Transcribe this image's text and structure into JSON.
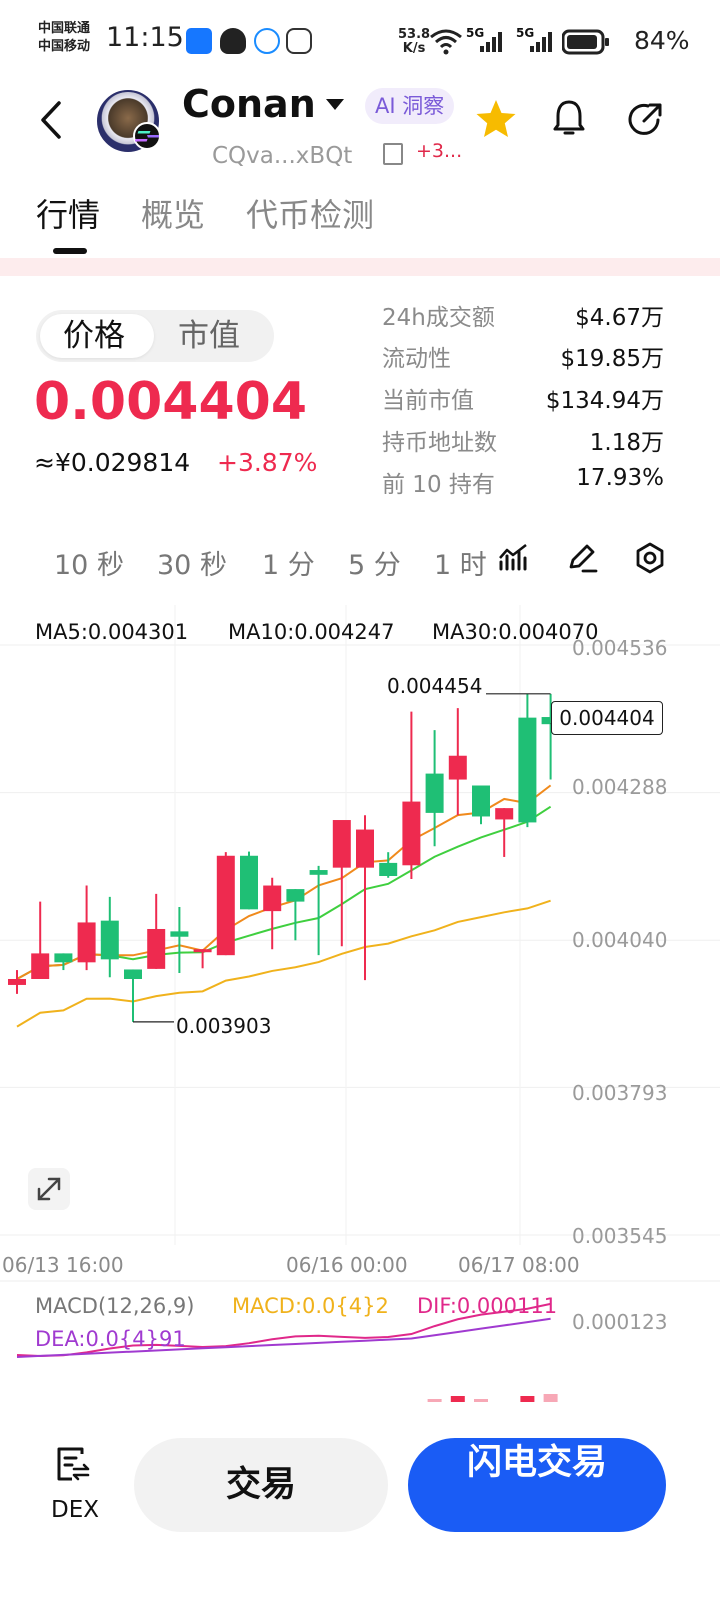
{
  "status_bar": {
    "carrier_1": "中国联通",
    "carrier_2": "中国移动",
    "time": "11:15",
    "net_speed_value": "53.8",
    "net_speed_unit": "K/s",
    "signal_1": "5G",
    "signal_2": "5G",
    "battery": "84%"
  },
  "header": {
    "token_name": "Conan",
    "ai_label": "AI 洞察",
    "address": "CQva...xBQt",
    "more": "+3...",
    "icons": [
      "back-icon",
      "star-icon",
      "bell-icon",
      "share-icon",
      "copy-icon",
      "caret-down-icon"
    ]
  },
  "tabs": [
    {
      "label": "行情",
      "active": true
    },
    {
      "label": "概览",
      "active": false
    },
    {
      "label": "代币检测",
      "active": false
    }
  ],
  "price_panel": {
    "toggle": [
      "价格",
      "市值"
    ],
    "price": "0.004404",
    "cny": "≈¥0.029814",
    "change": "+3.87%",
    "up_color": "#ee2a4f",
    "down_color": "#1fbf75",
    "stats": [
      {
        "label": "24h成交额",
        "value": "$4.67万"
      },
      {
        "label": "流动性",
        "value": "$19.85万"
      },
      {
        "label": "当前市值",
        "value": "$134.94万"
      },
      {
        "label": "持币地址数",
        "value": "1.18万"
      },
      {
        "label": "前 10 持有",
        "value": "17.93%"
      }
    ]
  },
  "intervals": [
    "10 秒",
    "30 秒",
    "1 分",
    "5 分",
    "1 时"
  ],
  "chart_data": {
    "type": "candlestick",
    "ma": [
      {
        "label": "MA5:0.004301",
        "color": "#f08a1c"
      },
      {
        "label": "MA10:0.004247",
        "color": "#3fcf3f"
      },
      {
        "label": "MA30:0.004070",
        "color": "#f0b21c"
      }
    ],
    "y_ticks": [
      "0.004536",
      "0.004288",
      "0.004040",
      "0.003793",
      "0.003545"
    ],
    "x_ticks": [
      "06/13 16:00",
      "06/16 00:00",
      "06/17 08:00"
    ],
    "ylim": [
      0.003545,
      0.004536
    ],
    "high_label": "0.004454",
    "low_label": "0.003903",
    "last_price_label": "0.004404",
    "candles": [
      {
        "o": 0.003965,
        "c": 0.003975,
        "h": 0.00399,
        "l": 0.00395
      },
      {
        "o": 0.003975,
        "c": 0.004018,
        "h": 0.004105,
        "l": 0.003975
      },
      {
        "o": 0.004018,
        "c": 0.004003,
        "h": 0.004018,
        "l": 0.00399
      },
      {
        "o": 0.004003,
        "c": 0.00407,
        "h": 0.004132,
        "l": 0.00399
      },
      {
        "o": 0.004073,
        "c": 0.004008,
        "h": 0.004113,
        "l": 0.003978
      },
      {
        "o": 0.003991,
        "c": 0.003975,
        "h": 0.003991,
        "l": 0.003903
      },
      {
        "o": 0.003992,
        "c": 0.004059,
        "h": 0.004118,
        "l": 0.003992
      },
      {
        "o": 0.004055,
        "c": 0.004046,
        "h": 0.004096,
        "l": 0.003985
      },
      {
        "o": 0.004023,
        "c": 0.004025,
        "h": 0.004025,
        "l": 0.003993
      },
      {
        "o": 0.004015,
        "c": 0.004182,
        "h": 0.004188,
        "l": 0.004015
      },
      {
        "o": 0.004182,
        "c": 0.004092,
        "h": 0.004189,
        "l": 0.004092
      },
      {
        "o": 0.004089,
        "c": 0.004132,
        "h": 0.004145,
        "l": 0.004025
      },
      {
        "o": 0.004126,
        "c": 0.004105,
        "h": 0.004126,
        "l": 0.00404
      },
      {
        "o": 0.004158,
        "c": 0.00415,
        "h": 0.004165,
        "l": 0.004015
      },
      {
        "o": 0.004162,
        "c": 0.004242,
        "h": 0.00423,
        "l": 0.00403
      },
      {
        "o": 0.004162,
        "c": 0.004226,
        "h": 0.00425,
        "l": 0.003973
      },
      {
        "o": 0.00417,
        "c": 0.004148,
        "h": 0.004188,
        "l": 0.004145
      },
      {
        "o": 0.004166,
        "c": 0.004273,
        "h": 0.004424,
        "l": 0.004143
      },
      {
        "o": 0.00432,
        "c": 0.004254,
        "h": 0.004393,
        "l": 0.004198
      },
      {
        "o": 0.00431,
        "c": 0.00435,
        "h": 0.00443,
        "l": 0.00425
      },
      {
        "o": 0.0043,
        "c": 0.004248,
        "h": 0.004275,
        "l": 0.004235
      },
      {
        "o": 0.004243,
        "c": 0.004262,
        "h": 0.004262,
        "l": 0.00418
      },
      {
        "o": 0.004414,
        "c": 0.004238,
        "h": 0.004454,
        "l": 0.00423
      },
      {
        "o": 0.004415,
        "c": 0.004403,
        "h": 0.004454,
        "l": 0.00431
      }
    ],
    "macd": {
      "title": "MACD(12,26,9)",
      "macd_label": "MACD:0.0{4}2",
      "dif_label": "DIF:0.000111",
      "dea_label": "DEA:0.0{4}91",
      "y_tick": "0.000123",
      "colors": {
        "title": "#777777",
        "macd": "#f0b21c",
        "dif": "#e0288a",
        "dea": "#a03ad0"
      }
    }
  },
  "bottom_bar": {
    "dex_label": "DEX",
    "trade_label": "交易",
    "flash_label": "闪电交易"
  }
}
